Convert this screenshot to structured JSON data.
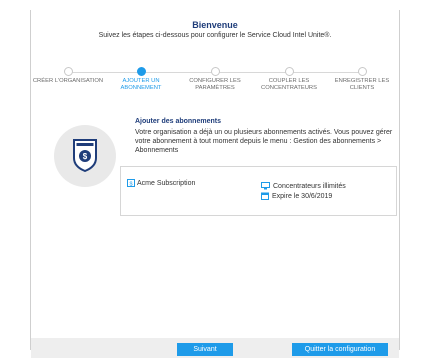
{
  "header": {
    "title": "Bienvenue",
    "subtitle": "Suivez les étapes ci-dessous pour configurer le Service Cloud Intel Unite®."
  },
  "steps": [
    {
      "label": "CRÉER L'ORGANISATION",
      "state": "done"
    },
    {
      "label": "AJOUTER UN ABONNEMENT",
      "state": "active"
    },
    {
      "label": "CONFIGURER LES PARAMÈTRES",
      "state": "pending"
    },
    {
      "label": "COUPLER LES CONCENTRATEURS",
      "state": "pending"
    },
    {
      "label": "ENREGISTRER LES CLIENTS",
      "state": "pending"
    }
  ],
  "section": {
    "title": "Ajouter des abonnements",
    "description": "Votre organisation a déjà un ou plusieurs abonnements activés. Vous pouvez gérer votre abonnement à tout moment depuis le menu : Gestion des abonnements > Abonnements"
  },
  "subscription": {
    "name": "Acme Subscription",
    "hubs": "Concentrateurs illimités",
    "expiry": "Expire le 30/6/2019"
  },
  "footer": {
    "next_label": "Suivant",
    "quit_label": "Quitter la configuration"
  },
  "colors": {
    "accent": "#1e9be9",
    "title": "#1f3d7a",
    "icon_bg": "#e9e9e9"
  }
}
